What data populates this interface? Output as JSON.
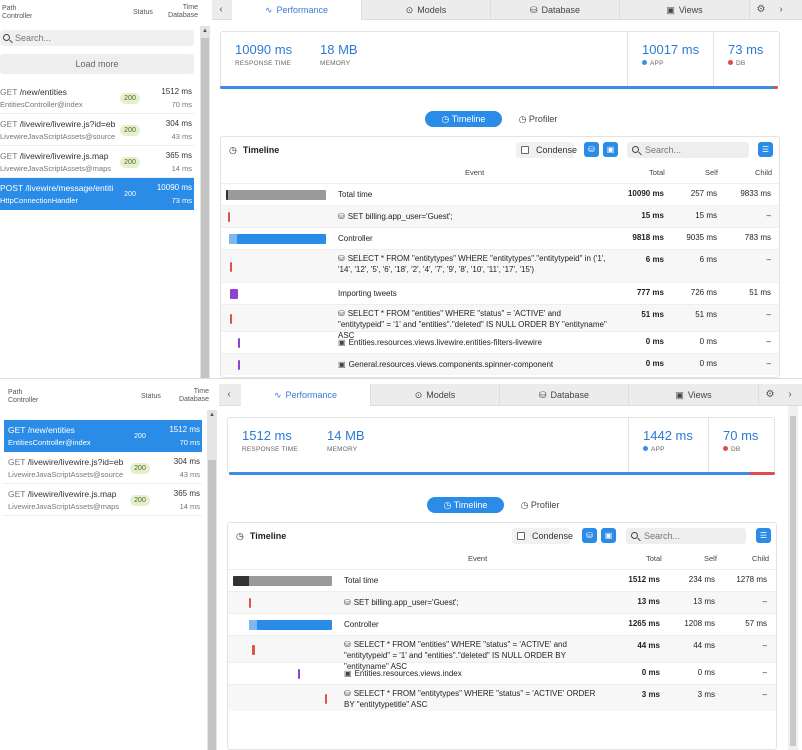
{
  "left_header": {
    "path": "Path",
    "controller": "Controller",
    "status": "Status",
    "time": "Time",
    "database": "Database"
  },
  "search_placeholder": "Search...",
  "load_more": "Load more",
  "tabs": {
    "performance": "Performance",
    "models": "Models",
    "database": "Database",
    "views": "Views"
  },
  "toggle": {
    "timeline": "Timeline",
    "profiler": "Profiler"
  },
  "timeline": {
    "title": "Timeline",
    "condense": "Condense",
    "search_placeholder": "Search...",
    "cols": {
      "event": "Event",
      "total": "Total",
      "self": "Self",
      "child": "Child"
    }
  },
  "panels": [
    {
      "requests": [
        {
          "method": "GET",
          "path": "/new/entities",
          "controller": "EntitiesController@index",
          "status": "200",
          "time": "1512 ms",
          "db": "70 ms",
          "active": false
        },
        {
          "method": "GET",
          "path": "/livewire/livewire.js?id=eb",
          "controller": "LivewireJavaScriptAssets@source",
          "status": "200",
          "time": "304 ms",
          "db": "43 ms",
          "active": false
        },
        {
          "method": "GET",
          "path": "/livewire/livewire.js.map",
          "controller": "LivewireJavaScriptAssets@maps",
          "status": "200",
          "time": "365 ms",
          "db": "14 ms",
          "active": false
        },
        {
          "method": "POST",
          "path": "/livewire/message/entiti",
          "controller": "HttpConnectionHandler",
          "status": "200",
          "time": "10090 ms",
          "db": "73 ms",
          "active": true
        }
      ],
      "stats": {
        "response_time": {
          "value": "10090 ms",
          "label": "RESPONSE TIME"
        },
        "memory": {
          "value": "18 MB",
          "label": "MEMORY"
        },
        "app": {
          "value": "10017 ms",
          "label": "APP",
          "color": "#3a8ee6"
        },
        "db": {
          "value": "73 ms",
          "label": "DB",
          "color": "#e04b4b"
        }
      },
      "app_fraction": 0.993,
      "rows": [
        {
          "event": "Total time",
          "icon": "",
          "total": "10090 ms",
          "self": "257 ms",
          "child": "9833 ms",
          "bar_color": "gray",
          "bar_start": 0.0,
          "bar_width": 1.0
        },
        {
          "event": "SET billing.app_user='Guest';",
          "icon": "db-icon",
          "total": "15 ms",
          "self": "15 ms",
          "child": "–",
          "bar_color": "red",
          "bar_start": 0.02,
          "bar_width": 0.0015
        },
        {
          "event": "Controller",
          "icon": "",
          "total": "9818 ms",
          "self": "9035 ms",
          "child": "783 ms",
          "bar_color": "blue",
          "bar_start": 0.03,
          "bar_width": 0.97
        },
        {
          "event": "SELECT * FROM \"entitytypes\" WHERE \"entitytypes\".\"entitytypeid\" in ('1', '14', '12', '5', '6', '18', '2', '4', '7', '9', '8', '10', '11', '17', '15')",
          "icon": "db-icon",
          "total": "6 ms",
          "self": "6 ms",
          "child": "–",
          "bar_color": "red",
          "bar_start": 0.04,
          "bar_width": 0.0006
        },
        {
          "event": "Importing tweets",
          "icon": "",
          "total": "777 ms",
          "self": "726 ms",
          "child": "51 ms",
          "bar_color": "purple",
          "bar_start": 0.04,
          "bar_width": 0.077
        },
        {
          "event": "SELECT * FROM \"entities\" WHERE \"status\" = 'ACTIVE' and \"entitytypeid\" = '1' and \"entities\".\"deleted\" IS NULL ORDER BY \"entityname\" ASC",
          "icon": "db-icon",
          "total": "51 ms",
          "self": "51 ms",
          "child": "–",
          "bar_color": "red",
          "bar_start": 0.04,
          "bar_width": 0.005
        },
        {
          "event": "Entities.resources.views.livewire.entities-filters-livewire",
          "icon": "img-icon",
          "total": "0 ms",
          "self": "0 ms",
          "child": "–",
          "bar_color": "purple",
          "bar_start": 0.115,
          "bar_width": 0.0
        },
        {
          "event": "General.resources.views.components.spinner-component",
          "icon": "img-icon",
          "total": "0 ms",
          "self": "0 ms",
          "child": "–",
          "bar_color": "purple",
          "bar_start": 0.115,
          "bar_width": 0.0
        }
      ]
    },
    {
      "requests": [
        {
          "method": "GET",
          "path": "/new/entities",
          "controller": "EntitiesController@index",
          "status": "200",
          "time": "1512 ms",
          "db": "70 ms",
          "active": true
        },
        {
          "method": "GET",
          "path": "/livewire/livewire.js?id=eb",
          "controller": "LivewireJavaScriptAssets@source",
          "status": "200",
          "time": "304 ms",
          "db": "43 ms",
          "active": false
        },
        {
          "method": "GET",
          "path": "/livewire/livewire.js.map",
          "controller": "LivewireJavaScriptAssets@maps",
          "status": "200",
          "time": "365 ms",
          "db": "14 ms",
          "active": false
        }
      ],
      "stats": {
        "response_time": {
          "value": "1512 ms",
          "label": "RESPONSE TIME"
        },
        "memory": {
          "value": "14 MB",
          "label": "MEMORY"
        },
        "app": {
          "value": "1442 ms",
          "label": "APP",
          "color": "#3a8ee6"
        },
        "db": {
          "value": "70 ms",
          "label": "DB",
          "color": "#e04b4b"
        }
      },
      "app_fraction": 0.954,
      "rows": [
        {
          "event": "Total time",
          "icon": "",
          "total": "1512 ms",
          "self": "234 ms",
          "child": "1278 ms",
          "bar_color": "gray",
          "bar_start": 0.0,
          "bar_width": 1.0
        },
        {
          "event": "SET billing.app_user='Guest';",
          "icon": "db-icon",
          "total": "13 ms",
          "self": "13 ms",
          "child": "–",
          "bar_color": "red",
          "bar_start": 0.16,
          "bar_width": 0.009
        },
        {
          "event": "Controller",
          "icon": "",
          "total": "1265 ms",
          "self": "1208 ms",
          "child": "57 ms",
          "bar_color": "blue",
          "bar_start": 0.16,
          "bar_width": 0.84
        },
        {
          "event": "SELECT * FROM \"entities\" WHERE \"status\" = 'ACTIVE' and \"entitytypeid\" = '1' and \"entities\".\"deleted\" IS NULL ORDER BY \"entityname\" ASC",
          "icon": "db-icon",
          "total": "44 ms",
          "self": "44 ms",
          "child": "–",
          "bar_color": "red",
          "bar_start": 0.19,
          "bar_width": 0.029
        },
        {
          "event": "Entities.resources.views.index",
          "icon": "img-icon",
          "total": "0 ms",
          "self": "0 ms",
          "child": "–",
          "bar_color": "purple",
          "bar_start": 0.66,
          "bar_width": 0.0
        },
        {
          "event": "SELECT * FROM \"entitytypes\" WHERE \"status\" = 'ACTIVE' ORDER BY \"entitytypetitle\" ASC",
          "icon": "db-icon",
          "total": "3 ms",
          "self": "3 ms",
          "child": "–",
          "bar_color": "red",
          "bar_start": 0.93,
          "bar_width": 0.002
        }
      ]
    }
  ]
}
